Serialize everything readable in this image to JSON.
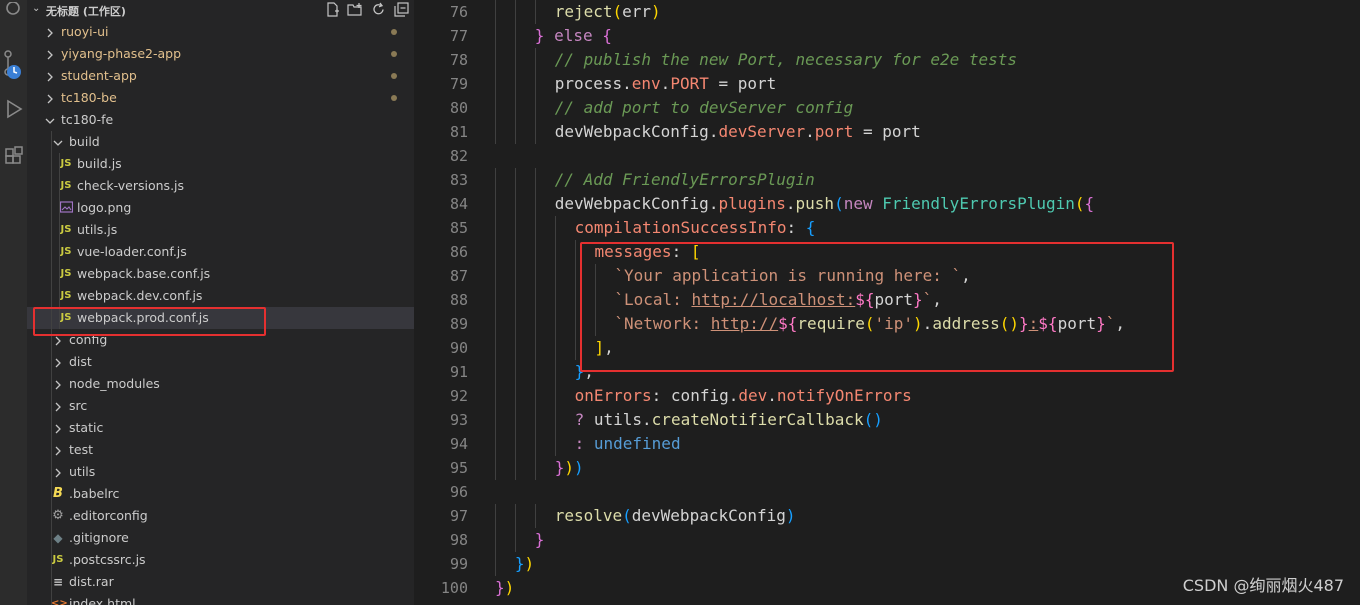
{
  "explorer": {
    "workspace_title": "无标题 (工作区)",
    "actions": [
      "new-file-icon",
      "new-folder-icon",
      "refresh-icon",
      "collapse-all-icon"
    ],
    "items": [
      {
        "label": "ruoyi-ui",
        "kind": "folder",
        "expanded": false,
        "depth": 0,
        "git": true,
        "dot": true
      },
      {
        "label": "yiyang-phase2-app",
        "kind": "folder",
        "expanded": false,
        "depth": 0,
        "git": true,
        "dot": true
      },
      {
        "label": "student-app",
        "kind": "folder",
        "expanded": false,
        "depth": 0,
        "git": true,
        "dot": true
      },
      {
        "label": "tc180-be",
        "kind": "folder",
        "expanded": false,
        "depth": 0,
        "git": true,
        "dot": true
      },
      {
        "label": "tc180-fe",
        "kind": "folder",
        "expanded": true,
        "depth": 0,
        "git": false,
        "dot": false
      },
      {
        "label": "build",
        "kind": "folder",
        "expanded": true,
        "depth": 1
      },
      {
        "label": "build.js",
        "kind": "js",
        "depth": 2
      },
      {
        "label": "check-versions.js",
        "kind": "js",
        "depth": 2
      },
      {
        "label": "logo.png",
        "kind": "image",
        "depth": 2
      },
      {
        "label": "utils.js",
        "kind": "js",
        "depth": 2
      },
      {
        "label": "vue-loader.conf.js",
        "kind": "js",
        "depth": 2
      },
      {
        "label": "webpack.base.conf.js",
        "kind": "js",
        "depth": 2
      },
      {
        "label": "webpack.dev.conf.js",
        "kind": "js",
        "depth": 2
      },
      {
        "label": "webpack.prod.conf.js",
        "kind": "js",
        "depth": 2,
        "selected": true
      },
      {
        "label": "config",
        "kind": "folder",
        "expanded": false,
        "depth": 1
      },
      {
        "label": "dist",
        "kind": "folder",
        "expanded": false,
        "depth": 1
      },
      {
        "label": "node_modules",
        "kind": "folder",
        "expanded": false,
        "depth": 1
      },
      {
        "label": "src",
        "kind": "folder",
        "expanded": false,
        "depth": 1
      },
      {
        "label": "static",
        "kind": "folder",
        "expanded": false,
        "depth": 1
      },
      {
        "label": "test",
        "kind": "folder",
        "expanded": false,
        "depth": 1
      },
      {
        "label": "utils",
        "kind": "folder",
        "expanded": false,
        "depth": 1
      },
      {
        "label": ".babelrc",
        "kind": "babel",
        "depth": 1
      },
      {
        "label": ".editorconfig",
        "kind": "gear",
        "depth": 1
      },
      {
        "label": ".gitignore",
        "kind": "gitignore",
        "depth": 1
      },
      {
        "label": ".postcssrc.js",
        "kind": "js",
        "depth": 1
      },
      {
        "label": "dist.rar",
        "kind": "archive",
        "depth": 1
      },
      {
        "label": "index.html",
        "kind": "html",
        "depth": 1
      }
    ]
  },
  "editor": {
    "lines": [
      {
        "n": "76",
        "indent": 3,
        "tokens": [
          [
            "fn",
            "reject"
          ],
          [
            "p1",
            "("
          ],
          [
            "id",
            "err"
          ],
          [
            "p1",
            ")"
          ]
        ]
      },
      {
        "n": "77",
        "indent": 2,
        "tokens": [
          [
            "p2",
            "}"
          ],
          [
            "id",
            " "
          ],
          [
            "kw",
            "else"
          ],
          [
            "id",
            " "
          ],
          [
            "p2",
            "{"
          ]
        ]
      },
      {
        "n": "78",
        "indent": 3,
        "tokens": [
          [
            "cm",
            "// publish the new Port, necessary for e2e tests"
          ]
        ]
      },
      {
        "n": "79",
        "indent": 3,
        "tokens": [
          [
            "id",
            "process"
          ],
          [
            "id",
            "."
          ],
          [
            "prop",
            "env"
          ],
          [
            "id",
            "."
          ],
          [
            "prop",
            "PORT"
          ],
          [
            "id",
            " = port"
          ]
        ]
      },
      {
        "n": "80",
        "indent": 3,
        "tokens": [
          [
            "cm",
            "// add port to devServer config"
          ]
        ]
      },
      {
        "n": "81",
        "indent": 3,
        "tokens": [
          [
            "id",
            "devWebpackConfig"
          ],
          [
            "id",
            "."
          ],
          [
            "prop",
            "devServer"
          ],
          [
            "id",
            "."
          ],
          [
            "prop",
            "port"
          ],
          [
            "id",
            " = port"
          ]
        ]
      },
      {
        "n": "82",
        "indent": 0,
        "tokens": []
      },
      {
        "n": "83",
        "indent": 3,
        "tokens": [
          [
            "cm",
            "// Add FriendlyErrorsPlugin"
          ]
        ]
      },
      {
        "n": "84",
        "indent": 3,
        "tokens": [
          [
            "id",
            "devWebpackConfig"
          ],
          [
            "id",
            "."
          ],
          [
            "prop",
            "plugins"
          ],
          [
            "id",
            "."
          ],
          [
            "fn",
            "push"
          ],
          [
            "p3",
            "("
          ],
          [
            "kw",
            "new"
          ],
          [
            "id",
            " "
          ],
          [
            "cls",
            "FriendlyErrorsPlugin"
          ],
          [
            "p1",
            "("
          ],
          [
            "p2",
            "{"
          ]
        ]
      },
      {
        "n": "85",
        "indent": 4,
        "tokens": [
          [
            "prop",
            "compilationSuccessInfo"
          ],
          [
            "id",
            ": "
          ],
          [
            "p3",
            "{"
          ]
        ]
      },
      {
        "n": "86",
        "indent": 5,
        "tokens": [
          [
            "prop",
            "messages"
          ],
          [
            "id",
            ": "
          ],
          [
            "p1",
            "["
          ]
        ]
      },
      {
        "n": "87",
        "indent": 6,
        "tokens": [
          [
            "str",
            "`Your application is running here: `"
          ],
          [
            "id",
            ","
          ]
        ]
      },
      {
        "n": "88",
        "indent": 6,
        "tokens": [
          [
            "str",
            "`Local: "
          ],
          [
            "url",
            "http://localhost:"
          ],
          [
            "tpl",
            "${"
          ],
          [
            "id",
            "port"
          ],
          [
            "tpl",
            "}"
          ],
          [
            "str",
            "`"
          ],
          [
            "id",
            ","
          ]
        ]
      },
      {
        "n": "89",
        "indent": 6,
        "tokens": [
          [
            "str",
            "`Network: "
          ],
          [
            "url",
            "http://"
          ],
          [
            "tpl",
            "${"
          ],
          [
            "fn",
            "require"
          ],
          [
            "p1",
            "("
          ],
          [
            "str",
            "'ip'"
          ],
          [
            "p1",
            ")"
          ],
          [
            "id",
            "."
          ],
          [
            "fn",
            "address"
          ],
          [
            "p1",
            "()"
          ],
          [
            "tpl",
            "}"
          ],
          [
            "url",
            ":"
          ],
          [
            "tpl",
            "${"
          ],
          [
            "id",
            "port"
          ],
          [
            "tpl",
            "}"
          ],
          [
            "str",
            "`"
          ],
          [
            "id",
            ","
          ]
        ]
      },
      {
        "n": "90",
        "indent": 5,
        "tokens": [
          [
            "p1",
            "]"
          ],
          [
            "id",
            ","
          ]
        ]
      },
      {
        "n": "91",
        "indent": 4,
        "tokens": [
          [
            "p3",
            "}"
          ],
          [
            "id",
            ","
          ]
        ]
      },
      {
        "n": "92",
        "indent": 4,
        "tokens": [
          [
            "prop",
            "onErrors"
          ],
          [
            "id",
            ": config"
          ],
          [
            "id",
            "."
          ],
          [
            "prop",
            "dev"
          ],
          [
            "id",
            "."
          ],
          [
            "prop",
            "notifyOnErrors"
          ]
        ]
      },
      {
        "n": "93",
        "indent": 4,
        "tokens": [
          [
            "kw",
            "?"
          ],
          [
            "id",
            " utils"
          ],
          [
            "id",
            "."
          ],
          [
            "fn",
            "createNotifierCallback"
          ],
          [
            "p3",
            "()"
          ]
        ]
      },
      {
        "n": "94",
        "indent": 4,
        "tokens": [
          [
            "kw",
            ":"
          ],
          [
            "id",
            " "
          ],
          [
            "und",
            "undefined"
          ]
        ]
      },
      {
        "n": "95",
        "indent": 3,
        "tokens": [
          [
            "p2",
            "}"
          ],
          [
            "p1",
            ")"
          ],
          [
            "p3",
            ")"
          ]
        ]
      },
      {
        "n": "96",
        "indent": 0,
        "tokens": []
      },
      {
        "n": "97",
        "indent": 3,
        "tokens": [
          [
            "fn",
            "resolve"
          ],
          [
            "p3",
            "("
          ],
          [
            "id",
            "devWebpackConfig"
          ],
          [
            "p3",
            ")"
          ]
        ]
      },
      {
        "n": "98",
        "indent": 2,
        "tokens": [
          [
            "p2",
            "}"
          ]
        ]
      },
      {
        "n": "99",
        "indent": 1,
        "tokens": [
          [
            "p3",
            "}"
          ],
          [
            "p1",
            ")"
          ]
        ]
      },
      {
        "n": "100",
        "indent": 0,
        "tokens": [
          [
            "p2",
            "}"
          ],
          [
            "p1",
            ")"
          ]
        ]
      }
    ]
  },
  "watermark": "CSDN @绚丽烟火487",
  "colors": {
    "highlight_box": "#e53030",
    "js_icon": "#cbcb41",
    "folder_git_label": "#e2c08d"
  }
}
